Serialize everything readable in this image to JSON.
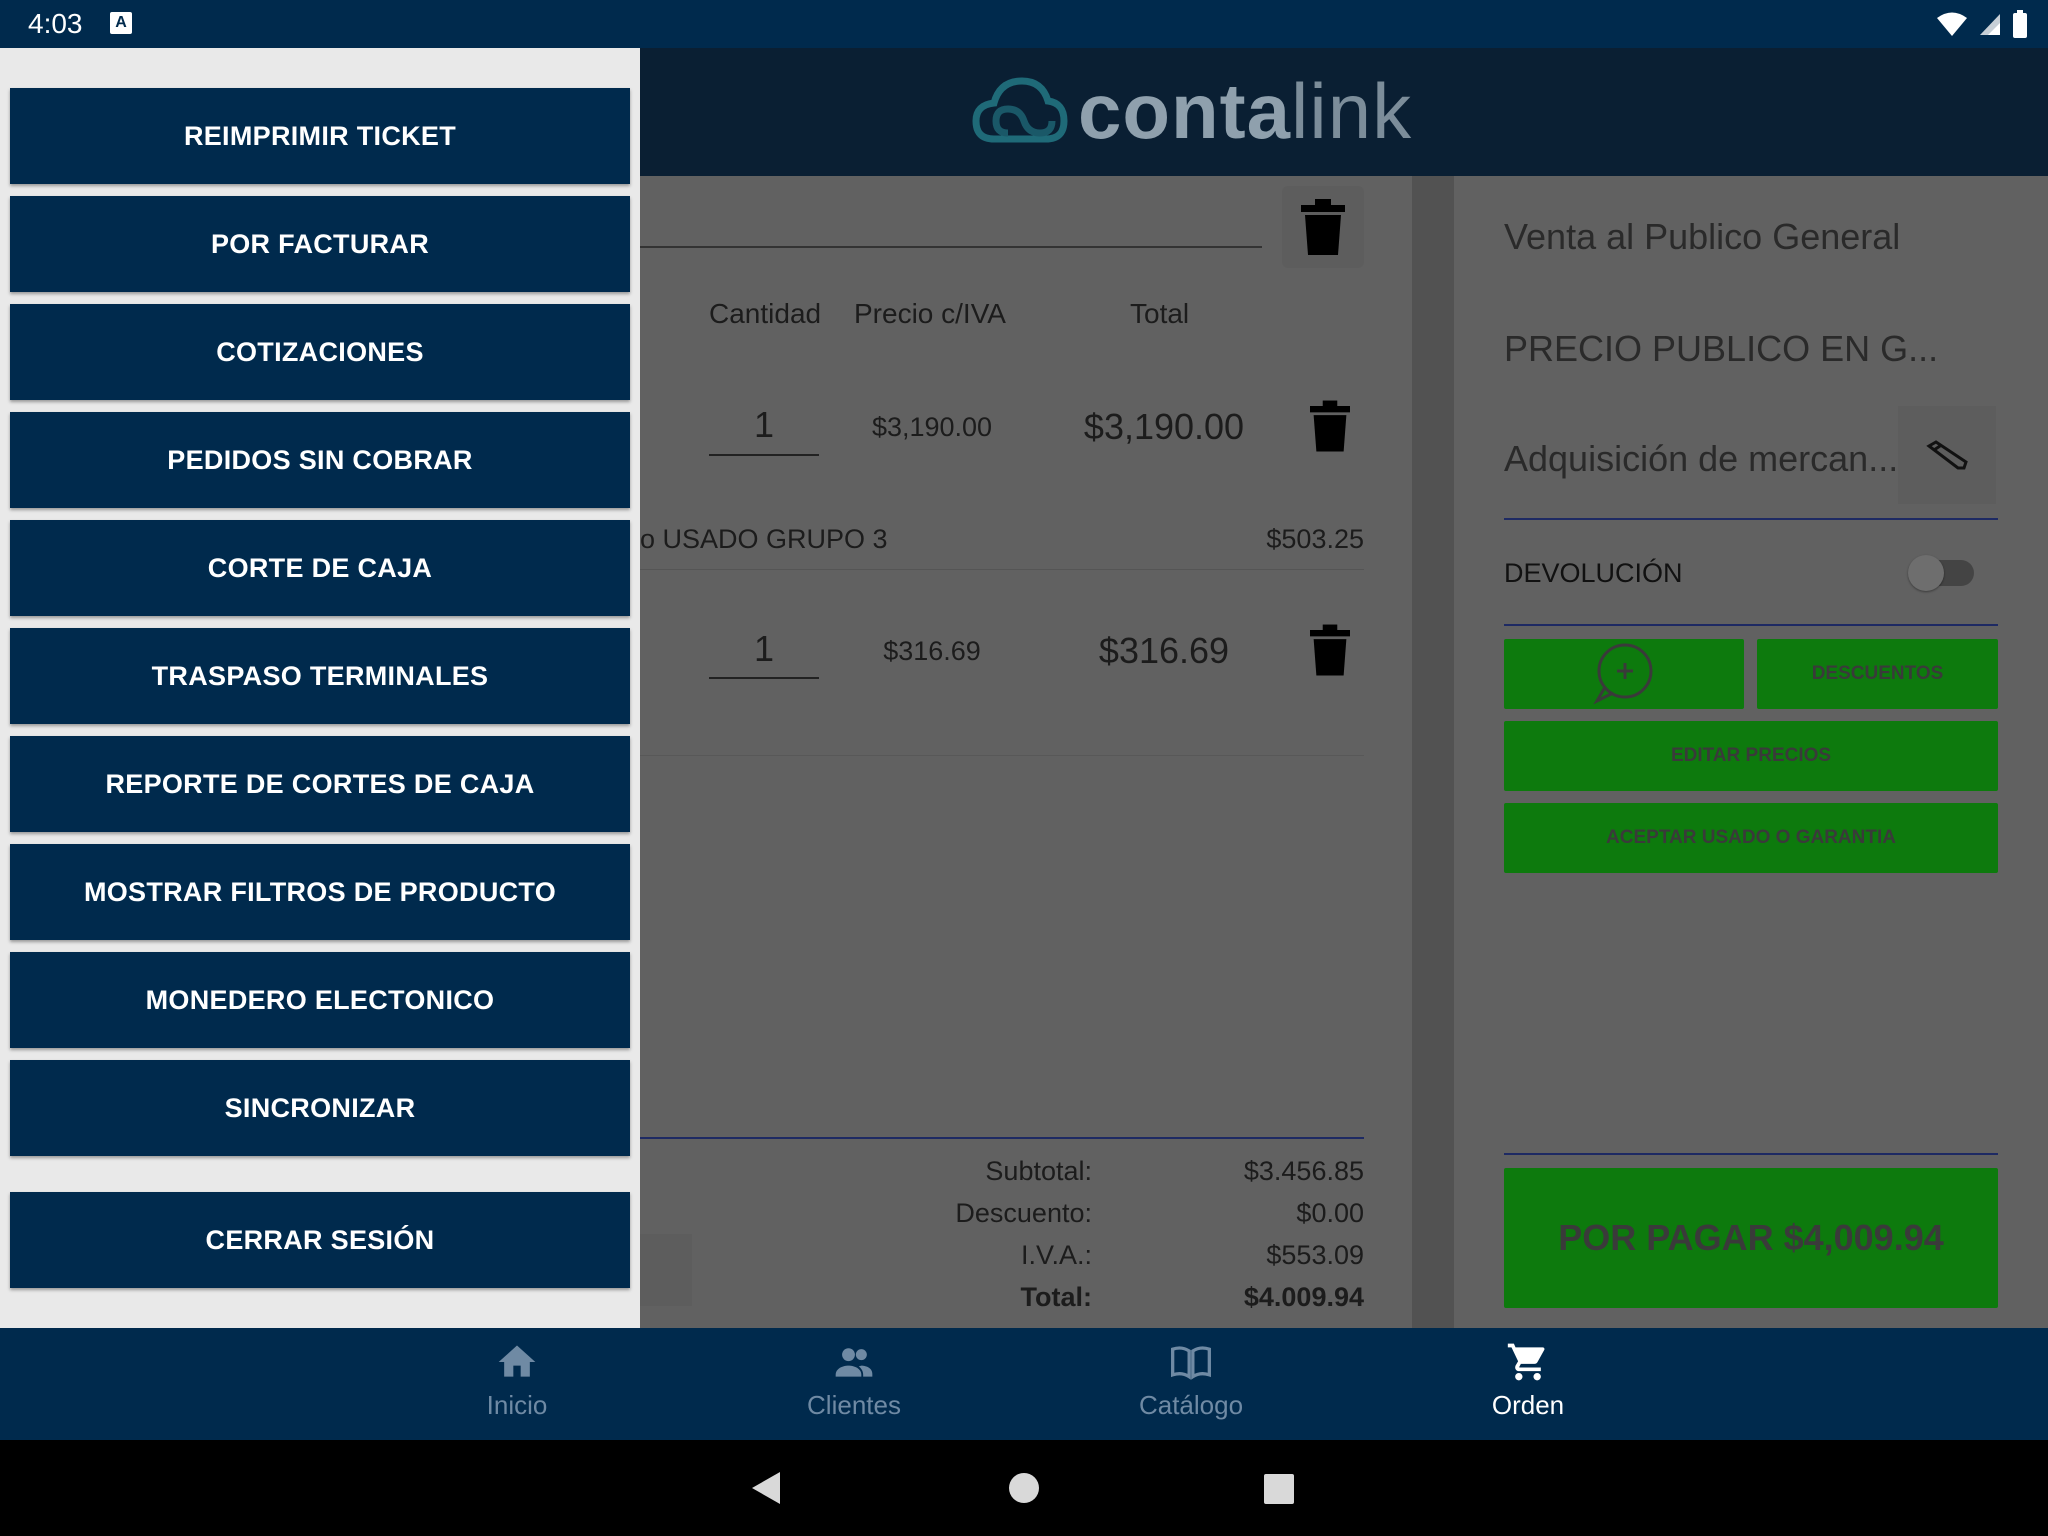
{
  "status_bar": {
    "time": "4:03",
    "notification_icon": "A"
  },
  "header": {
    "logo_part1": "conta",
    "logo_part2": "link"
  },
  "order": {
    "columns": {
      "quantity": "Cantidad",
      "price": "Precio c/IVA",
      "total": "Total"
    },
    "items": [
      {
        "quantity": "1",
        "price": "$3,190.00",
        "total": "$3,190.00"
      },
      {
        "quantity": "1",
        "price": "$316.69",
        "total": "$316.69"
      }
    ],
    "group_label": "o USADO GRUPO 3",
    "group_amount": "$503.25",
    "totals": {
      "subtotal_label": "Subtotal:",
      "subtotal_value": "$3.456.85",
      "discount_label": "Descuento:",
      "discount_value": "$0.00",
      "iva_label": "I.V.A.:",
      "iva_value": "$553.09",
      "total_label": "Total:",
      "total_value": "$4.009.94"
    }
  },
  "right_panel": {
    "client": "Venta al Publico General",
    "price_list": "PRECIO PUBLICO EN G...",
    "concept": "Adquisición de mercan...",
    "return_label": "DEVOLUCIÓN",
    "discounts_button": "DESCUENTOS",
    "edit_prices_button": "EDITAR PRECIOS",
    "accept_used_button": "ACEPTAR USADO O GARANTIA",
    "pay_button": "POR PAGAR $4,009.94"
  },
  "drawer": {
    "items": [
      "REIMPRIMIR TICKET",
      "POR FACTURAR",
      "COTIZACIONES",
      "PEDIDOS SIN COBRAR",
      "CORTE DE CAJA",
      "TRASPASO TERMINALES",
      "REPORTE DE CORTES DE CAJA",
      "MOSTRAR FILTROS DE PRODUCTO",
      "MONEDERO ELECTONICO",
      "SINCRONIZAR"
    ],
    "logout": "CERRAR SESIÓN"
  },
  "bottom_nav": {
    "items": [
      {
        "label": "Inicio",
        "icon": "home-icon"
      },
      {
        "label": "Clientes",
        "icon": "people-icon"
      },
      {
        "label": "Catálogo",
        "icon": "book-icon"
      },
      {
        "label": "Orden",
        "icon": "cart-icon"
      }
    ],
    "active": "Orden"
  },
  "colors": {
    "primary": "#002a4d",
    "green": "#0d7a0d",
    "drawer_bg": "#e9e9e9"
  }
}
